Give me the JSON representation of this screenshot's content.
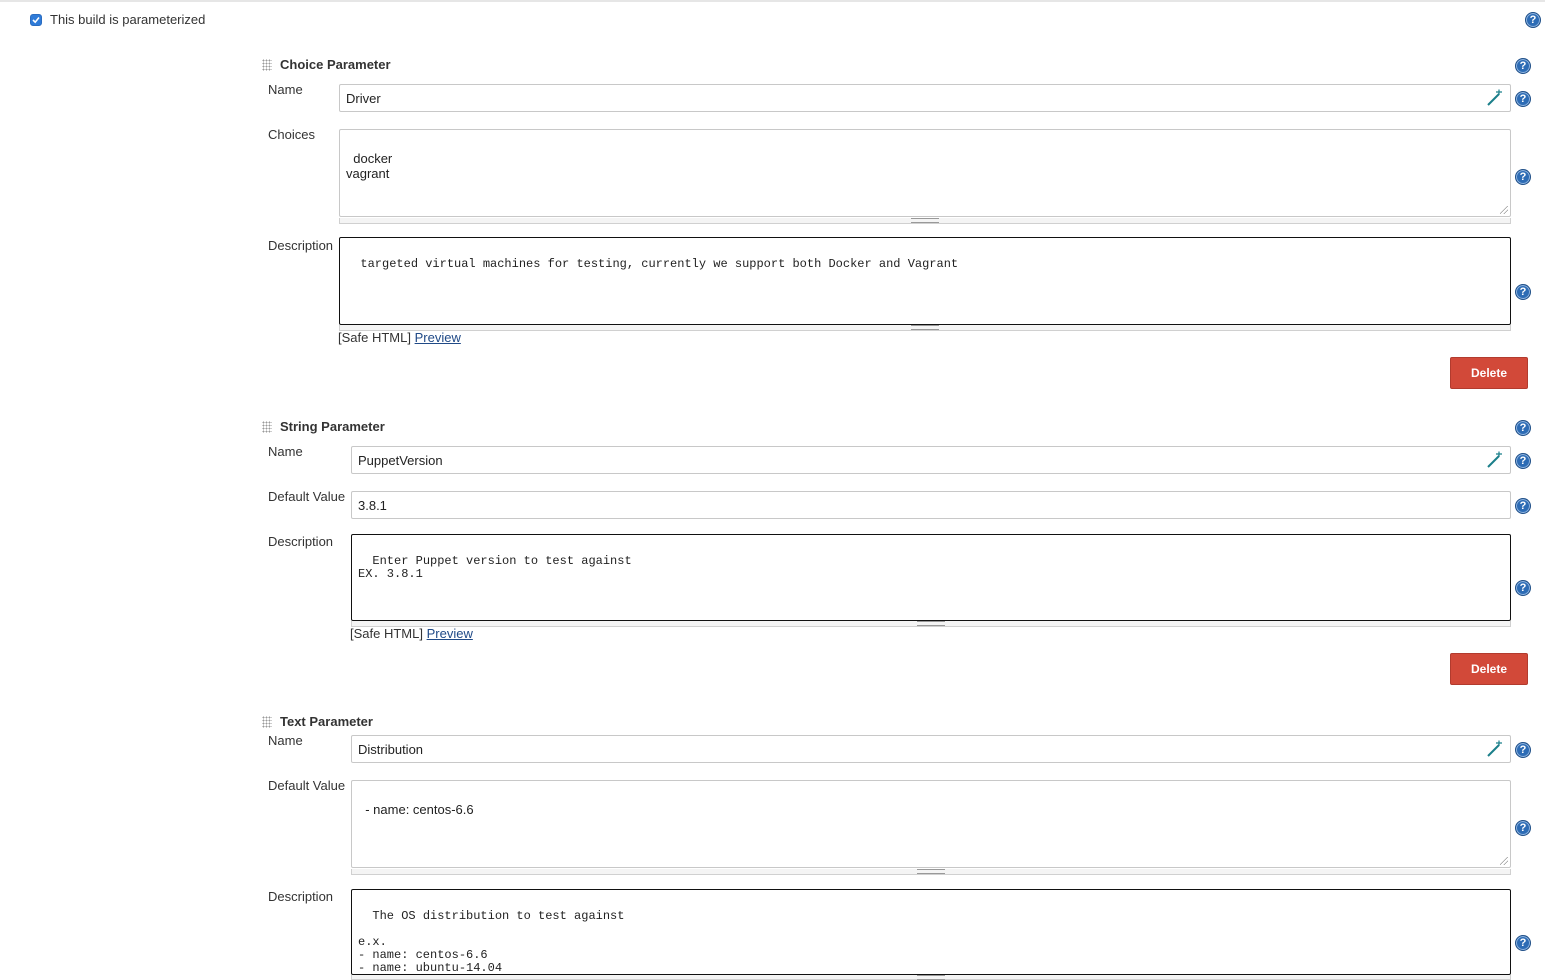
{
  "parameterized": {
    "label": "This build is parameterized",
    "checked": true
  },
  "help_glyph": "?",
  "choice": {
    "title": "Choice Parameter",
    "name_label": "Name",
    "name_value": "Driver",
    "choices_label": "Choices",
    "choices_value": "docker\nvagrant",
    "description_label": "Description",
    "description_value": "targeted virtual machines for testing, currently we support both Docker and Vagrant",
    "safe_html": "[Safe HTML]",
    "preview": "Preview",
    "delete": "Delete"
  },
  "string": {
    "title": "String Parameter",
    "name_label": "Name",
    "name_value": "PuppetVersion",
    "default_label": "Default Value",
    "default_value": "3.8.1",
    "description_label": "Description",
    "description_value": "Enter Puppet version to test against\nEX. 3.8.1",
    "safe_html": "[Safe HTML]",
    "preview": "Preview",
    "delete": "Delete"
  },
  "text": {
    "title": "Text Parameter",
    "name_label": "Name",
    "name_value": "Distribution",
    "default_label": "Default Value",
    "default_value": "- name: centos-6.6",
    "description_label": "Description",
    "description_value": "The OS distribution to test against\n\ne.x.\n- name: centos-6.6\n- name: ubuntu-14.04"
  },
  "colors": {
    "delete_button": "#d24939",
    "help_icon": "#2d6cb5",
    "checkbox": "#2f7bd8",
    "link": "#204a87"
  },
  "icons": {
    "help": "help-icon",
    "wand": "magic-wand-icon",
    "drag": "drag-handle-icon"
  }
}
